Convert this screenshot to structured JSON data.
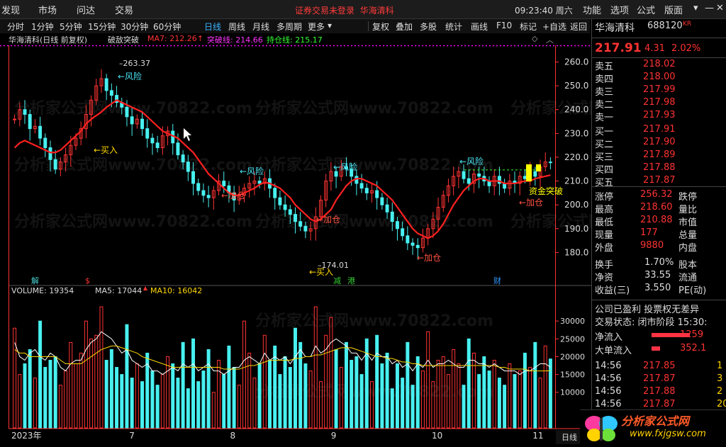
{
  "menubar": {
    "items": [
      "发现",
      "市场",
      "问达",
      "交易"
    ],
    "notice": "证券交易未登录",
    "notice_name": "华海清科",
    "clock": "09:23:40 周六",
    "right": [
      "功能",
      "选项",
      "公式",
      "版面"
    ],
    "win": [
      "▾",
      "—",
      "✕"
    ]
  },
  "tfbar": {
    "periods": [
      "分时",
      "1分钟",
      "5分钟",
      "15分钟",
      "30分钟",
      "60分钟",
      "日线",
      "周线",
      "月线",
      "多周期",
      "更多"
    ],
    "active": "日线",
    "tools": [
      "复权",
      "叠加",
      "多股",
      "统计",
      "画线",
      "F10",
      "标记",
      "+自选",
      "返回"
    ]
  },
  "indicator": {
    "title": "华海清科(日线 前复权)",
    "formula": "破敌突破",
    "ma7": "MA7: 212.26↑",
    "tupo": "突破线: 214.66",
    "chicang": "持仓线: 215.17"
  },
  "annotations": {
    "high": "263.37",
    "low": "174.01",
    "risk": "←风险",
    "buy": "←买入",
    "add": "←加仓",
    "risk_sym": "←风险",
    "fund": "资金突破"
  },
  "event_marks": [
    "解",
    "$",
    "减",
    "港",
    "财"
  ],
  "volume": {
    "label": "VOLUME: 19354",
    "ma5": "MA5: 17044",
    "ma10": "MA10: 16042"
  },
  "xaxis": {
    "labels": [
      "2023年",
      "7",
      "8",
      "9",
      "10",
      "11"
    ],
    "period": "日线"
  },
  "watermark": "分析家公式网www.70822.com",
  "colors": {
    "up": "#ff3333",
    "down": "#48f0f0",
    "ma": "#ff2020",
    "ma5": "#ffffff",
    "ma10": "#ffd700",
    "axis": "#ff3333"
  },
  "quote": {
    "name": "华海清科",
    "code": "688120",
    "kr": "KR",
    "price": "217.91",
    "change": "4.31",
    "pct": "2.02%"
  },
  "asks": [
    {
      "label": "卖五",
      "price": "218.02"
    },
    {
      "label": "卖四",
      "price": "218.00"
    },
    {
      "label": "卖三",
      "price": "217.99"
    },
    {
      "label": "卖二",
      "price": "217.98"
    },
    {
      "label": "卖一",
      "price": "217.93"
    }
  ],
  "bids": [
    {
      "label": "买一",
      "price": "217.91"
    },
    {
      "label": "买二",
      "price": "217.90"
    },
    {
      "label": "买三",
      "price": "217.89"
    },
    {
      "label": "买四",
      "price": "217.88"
    },
    {
      "label": "买五",
      "price": "217.87"
    }
  ],
  "stats": [
    {
      "l1": "涨停",
      "v1": "256.32",
      "l2": "跌停"
    },
    {
      "l1": "最高",
      "v1": "218.60",
      "l2": "量比"
    },
    {
      "l1": "最低",
      "v1": "210.88",
      "l2": "市值"
    },
    {
      "l1": "现量",
      "v1": "177",
      "l2": "总量"
    },
    {
      "l1": "外盘",
      "v1": "9880",
      "l2": "内盘"
    }
  ],
  "stats2": [
    {
      "l1": "换手",
      "v1": "1.70%",
      "l2": "股本"
    },
    {
      "l1": "净资",
      "v1": "33.55",
      "l2": "流通"
    },
    {
      "l1": "收益(三)",
      "v1": "3.550",
      "l2": "PE(动)"
    }
  ],
  "status": {
    "line1": "公司已盈利 投票权无差异",
    "line2": "交易状态: 闭市阶段 15:30:"
  },
  "flow": [
    {
      "l": "净流入",
      "v": "1259"
    },
    {
      "l": "大单流入",
      "v": "352.1"
    }
  ],
  "ticks": [
    {
      "t": "14:56",
      "p": "217.85",
      "v": "1"
    },
    {
      "t": "14:56",
      "p": "217.87",
      "v": "3"
    },
    {
      "t": "14:56",
      "p": "217.88",
      "v": "2"
    },
    {
      "t": "14:56",
      "p": "217.87",
      "v": "20"
    }
  ],
  "logo": {
    "l1": "分析家公式网",
    "l2": "www.fxjgsw.com"
  },
  "chart_data": {
    "type": "candlestick",
    "price_axis": {
      "ticks": [
        260,
        250,
        240,
        230,
        220,
        210,
        200,
        190,
        180
      ],
      "ylim": [
        170,
        267
      ]
    },
    "volume_axis": {
      "ticks": [
        30000,
        25000,
        20000,
        15000,
        10000
      ],
      "ylim": [
        0,
        37000
      ]
    },
    "seed_close": 236,
    "closes": [
      236,
      240,
      238,
      232,
      233,
      228,
      224,
      219,
      215,
      218,
      221,
      225,
      228,
      232,
      238,
      244,
      250,
      253,
      248,
      246,
      243,
      241,
      237,
      234,
      236,
      232,
      228,
      226,
      224,
      229,
      231,
      226,
      221,
      218,
      214,
      209,
      206,
      204,
      203,
      206,
      210,
      208,
      205,
      202,
      204,
      207,
      209,
      210,
      209,
      211,
      207,
      203,
      200,
      198,
      196,
      193,
      191,
      189,
      190,
      195,
      202,
      210,
      214,
      212,
      216,
      215,
      212,
      209,
      207,
      205,
      206,
      203,
      200,
      197,
      193,
      190,
      187,
      184,
      183,
      182,
      186,
      190,
      194,
      199,
      204,
      208,
      212,
      214,
      211,
      209,
      213,
      212,
      210,
      208,
      212,
      209,
      207,
      210,
      209,
      212,
      211,
      214,
      212,
      216,
      218,
      217.91
    ],
    "ma": [
      224,
      226,
      227,
      226,
      225,
      224,
      223,
      222,
      222,
      223,
      225,
      227,
      229,
      231,
      234,
      236,
      237.5,
      239,
      241,
      242.5,
      244,
      243,
      242,
      241,
      240,
      239,
      237,
      235,
      233,
      231,
      230,
      229,
      228,
      226,
      224,
      222,
      219,
      216,
      213,
      211,
      209,
      207,
      205,
      204,
      204,
      205,
      206,
      207,
      208.5,
      209.5,
      209,
      208,
      207,
      205,
      203,
      200,
      198,
      196,
      194,
      193,
      194,
      196,
      198,
      202,
      205,
      208,
      210,
      211,
      211,
      210,
      209,
      208,
      206,
      204,
      202,
      199,
      196,
      193,
      190,
      188,
      187,
      186,
      187,
      189,
      192,
      196,
      200,
      203,
      206,
      208,
      210,
      211,
      211,
      210,
      210,
      210,
      209,
      209,
      209,
      209.5,
      210,
      210,
      211,
      211.5,
      212,
      212.5
    ],
    "volumes": [
      28000,
      15000,
      18000,
      22000,
      14000,
      30000,
      17000,
      19000,
      20000,
      12000,
      16000,
      24000,
      18000,
      21000,
      30000,
      25000,
      26000,
      34000,
      19000,
      22000,
      17000,
      15000,
      29000,
      14000,
      18000,
      13000,
      21000,
      16000,
      12000,
      15000,
      20000,
      18000,
      14000,
      24000,
      11000,
      25000,
      13000,
      16000,
      22000,
      10000,
      19000,
      15000,
      23000,
      17000,
      12000,
      30000,
      21000,
      14000,
      18000,
      26000,
      19000,
      23000,
      15000,
      20000,
      17000,
      28000,
      24000,
      18000,
      16000,
      34000,
      13000,
      26000,
      31000,
      22000,
      17000,
      24000,
      19000,
      20000,
      15000,
      25000,
      13000,
      26000,
      18000,
      21000,
      11000,
      18000,
      14000,
      24000,
      12000,
      20000,
      16000,
      27000,
      13000,
      19000,
      20000,
      15000,
      22000,
      18000,
      12000,
      25000,
      21000,
      15000,
      20000,
      16000,
      19000,
      14000,
      12000,
      18000,
      15000,
      16000,
      21000,
      17000,
      24000,
      14000,
      23000,
      19354
    ],
    "ma5": [
      24000,
      20000,
      19000,
      21000,
      22000,
      20000,
      19000,
      21000,
      20000,
      17000,
      16000,
      18000,
      19000,
      19000,
      22000,
      24000,
      25000,
      27000,
      26000,
      25000,
      23000,
      21000,
      22000,
      19000,
      18000,
      17000,
      18000,
      16000,
      16000,
      15000,
      16000,
      17000,
      16000,
      18000,
      17000,
      18000,
      16000,
      17000,
      18000,
      16000,
      16000,
      15000,
      16000,
      17000,
      17000,
      19000,
      20000,
      19000,
      18000,
      21000,
      19000,
      20000,
      19000,
      20000,
      18000,
      20000,
      22000,
      20000,
      20000,
      23000,
      21000,
      22000,
      24000,
      25000,
      24000,
      23000,
      21000,
      21000,
      19000,
      21000,
      19000,
      21000,
      20000,
      20000,
      18000,
      19000,
      17000,
      18000,
      16000,
      18000,
      17000,
      19000,
      17000,
      18000,
      18000,
      19000,
      18000,
      17000,
      17000,
      19000,
      19000,
      18000,
      18000,
      17000,
      18000,
      17000,
      16000,
      16000,
      16000,
      15000,
      16000,
      16000,
      17000,
      18000,
      18000,
      17044
    ],
    "ma10": [
      22000,
      21000,
      21000,
      20000,
      20000,
      20000,
      20000,
      20000,
      20000,
      19000,
      18000,
      18000,
      18000,
      18000,
      19000,
      20000,
      21000,
      22000,
      22500,
      23000,
      23000,
      22500,
      22000,
      21500,
      21000,
      20000,
      19500,
      19000,
      18500,
      18000,
      17500,
      17000,
      17000,
      17000,
      17000,
      17000,
      17000,
      17000,
      17000,
      17000,
      17000,
      16500,
      16500,
      16500,
      16500,
      17000,
      17500,
      17500,
      18000,
      18500,
      19000,
      19000,
      19000,
      19000,
      19000,
      19500,
      19500,
      20000,
      20000,
      20500,
      20500,
      21000,
      21500,
      22000,
      22500,
      22500,
      22500,
      22000,
      21500,
      21000,
      20500,
      20000,
      20000,
      19500,
      19500,
      19000,
      18500,
      18500,
      18000,
      18000,
      17500,
      17500,
      17500,
      17500,
      17500,
      17500,
      17500,
      17500,
      17500,
      17500,
      17500,
      17500,
      17500,
      17500,
      17500,
      17000,
      17000,
      16500,
      16500,
      16500,
      16500,
      16000,
      16000,
      16000,
      16000,
      16042
    ],
    "ohlc_note": "daily candles, Jun-Nov 2023"
  }
}
